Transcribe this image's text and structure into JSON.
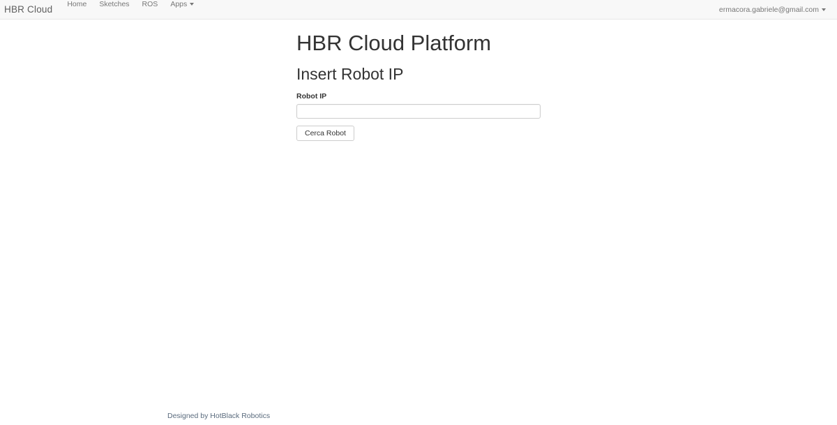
{
  "navbar": {
    "brand": "HBR Cloud",
    "items": [
      {
        "label": "Home"
      },
      {
        "label": "Sketches"
      },
      {
        "label": "ROS"
      },
      {
        "label": "Apps",
        "has_dropdown": true
      }
    ],
    "user_menu": {
      "label": "ermacora.gabriele@gmail.com",
      "has_dropdown": true
    }
  },
  "main": {
    "title": "HBR Cloud Platform",
    "subtitle": "Insert Robot IP",
    "form": {
      "label": "Robot IP",
      "input_value": "",
      "input_placeholder": "",
      "submit_label": "Cerca Robot"
    }
  },
  "footer": {
    "text": "Designed by HotBlack Robotics"
  },
  "colors": {
    "navbar_bg": "#f8f8f8",
    "navbar_border": "#e7e7e7",
    "nav_link": "#777777",
    "brand_text": "#5e5e5e",
    "heading_text": "#333333",
    "input_border": "#cccccc",
    "button_border": "#cccccc",
    "button_text": "#333333",
    "footer_link": "#5a6b7d"
  }
}
